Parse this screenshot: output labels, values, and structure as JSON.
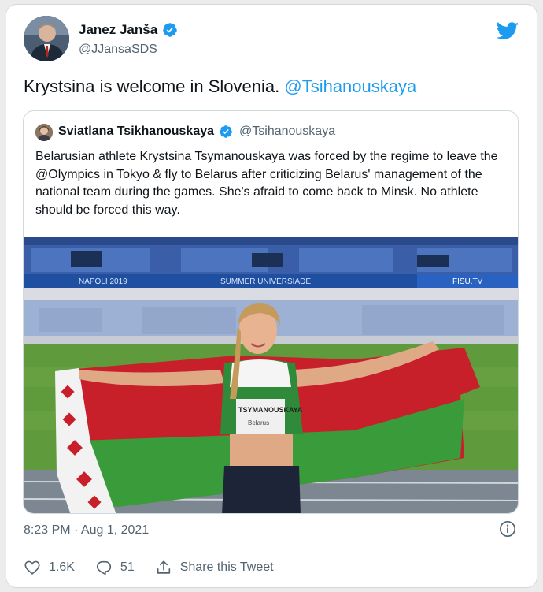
{
  "author": {
    "name": "Janez Janša",
    "handle": "@JJansaSDS"
  },
  "tweet": {
    "text_plain": "Krystsina is welcome in Slovenia. ",
    "mention": "@Tsihanouskaya"
  },
  "quoted": {
    "name": "Sviatlana Tsikhanouskaya",
    "handle": "@Tsihanouskaya",
    "text": "Belarusian athlete Krystsina Tsymanouskaya was forced by the regime to leave the @Olympics in Tokyo & fly to Belarus after criticizing Belarus' management of the national team during the games. She's afraid to come back to Minsk. No athlete should be forced this way.",
    "photo": {
      "banner_left": "NAPOLI 2019",
      "banner_mid": "SUMMER UNIVERSIADE",
      "banner_right": "FISU.TV",
      "bib_name": "TSYMANOUSKAYA",
      "bib_country": "Belarus"
    }
  },
  "meta": {
    "timestamp": "8:23 PM · Aug 1, 2021"
  },
  "actions": {
    "likes": "1.6K",
    "replies": "51",
    "share_label": "Share this Tweet"
  },
  "colors": {
    "accent": "#1d9bf0",
    "flag_red": "#c8202a",
    "flag_green": "#3a9b3a"
  }
}
